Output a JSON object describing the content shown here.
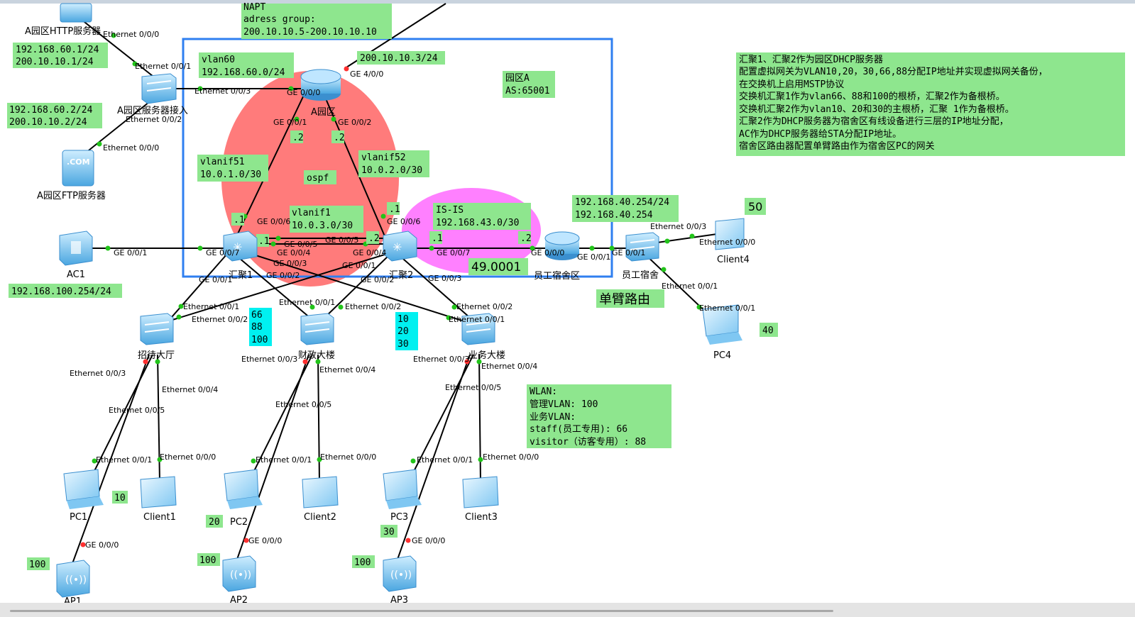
{
  "info_text": {
    "lines": [
      "汇聚1、汇聚2作为园区DHCP服务器",
      "配置虚拟网关为VLAN10,20，30,66,88分配IP地址并实现虚拟网关备份，",
      "在交换机上启用MSTP协议",
      "交换机汇聚1作为vlan66、88和100的根桥，汇聚2作为备根桥。",
      "交换机汇聚2作为vlan10、20和30的主根桥，汇聚 1作为备根桥。",
      "汇聚2作为DHCP服务器为宿舍区有线设备进行三层的IP地址分配，",
      "AC作为DHCP服务器给STA分配IP地址。",
      "宿舍区路由器配置单臂路由作为宿舍区PC的网关"
    ]
  },
  "wlan_box": {
    "lines": [
      "WLAN:",
      "管理VLAN: 100",
      "业务VLAN:",
      "staff(员工专用): 66",
      "visitor（访客专用）: 88"
    ]
  },
  "labels": {
    "napt": [
      "NAPT",
      "adress group:",
      "200.10.10.5-200.10.10.10"
    ],
    "http_ip": [
      "192.168.60.1/24",
      "200.10.10.1/24"
    ],
    "ftp_ip": [
      "192.168.60.2/24",
      "200.10.10.2/24"
    ],
    "vlan60": [
      "vlan60",
      "192.168.60.0/24"
    ],
    "wan_ip": "200.10.10.3/24",
    "campus": [
      "园区A",
      "AS:65001"
    ],
    "vlanif51": [
      "vlanif51",
      "10.0.1.0/30"
    ],
    "vlanif52": [
      "vlanif52",
      "10.0.2.0/30"
    ],
    "vlanif1": [
      "vlanif1",
      "10.0.3.0/30"
    ],
    "ospf": "ospf",
    "isis": [
      "IS-IS",
      "192.168.43.0/30"
    ],
    "isis_net": "49.0001",
    "dorm_ip": [
      "192.168.40.254/24",
      "192.168.40.254"
    ],
    "ac_ip": "192.168.100.254/24",
    "single_arm": "单臂路由",
    "vlan_a": [
      "66",
      "88",
      "100"
    ],
    "vlan_b": [
      "10",
      "20",
      "30"
    ],
    "pc1_vlan": "10",
    "pc2_vlan": "20",
    "pc3_vlan": "30",
    "pc4_vlan": "40",
    "client4_vlan": "50",
    "ap1_vlan": "100",
    "ap2_vlan": "100",
    "ap3_vlan": "100",
    "dot1": ".1",
    "dot2": ".2"
  },
  "devices": {
    "http_server": "A园区HTTP服务器",
    "server_access": "A园区服务器接入",
    "ftp_server": "A园区FTP服务器",
    "router_a": "A园区",
    "core1": "汇聚1",
    "core2": "汇聚2",
    "ac1": "AC1",
    "dorm_router": "员工宿舍区",
    "dorm_switch": "员工宿舍",
    "client4": "Client4",
    "pc4": "PC4",
    "reception": "招待大厅",
    "finance": "财政大楼",
    "business": "业务大楼",
    "pc1": "PC1",
    "client1": "Client1",
    "ap1": "AP1",
    "pc2": "PC2",
    "client2": "Client2",
    "ap2": "AP2",
    "pc3": "PC3",
    "client3": "Client3",
    "ap3": "AP3"
  },
  "ports": {
    "http_e000": "Ethernet 0/0/0",
    "sa_e001": "Ethernet 0/0/1",
    "sa_e003": "Ethernet 0/0/3",
    "sa_e002": "Ethernet 0/0/2",
    "ftp_e000": "Ethernet 0/0/0",
    "ra_ge400": "GE 4/0/0",
    "ra_ge000": "GE 0/0/0",
    "ra_ge001": "GE 0/0/1",
    "ra_ge002": "GE 0/0/2",
    "c1_ge006": "GE 0/0/6",
    "c1_ge007": "GE 0/0/7",
    "c1_ge005": "GE 0/0/5",
    "c1_ge004": "GE 0/0/4",
    "c1_ge003": "GE 0/0/3",
    "c1_ge002": "GE 0/0/2",
    "c1_ge001": "GE 0/0/1",
    "c2_ge005": "GE 0/0/5",
    "c2_ge006": "GE 0/0/6",
    "c2_ge004": "GE 0/0/4",
    "c2_ge001": "GE 0/0/1",
    "c2_ge002": "GE 0/0/2",
    "c2_ge003": "GE 0/0/3",
    "c2_ge007": "GE 0/0/7",
    "ac_ge001": "GE 0/0/1",
    "dr_ge000": "GE 0/0/0",
    "dr_ge001": "GE 0/0/1",
    "ds_ge001": "GE 0/0/1",
    "ds_e003": "Ethernet 0/0/3",
    "ds_e001": "Ethernet 0/0/1",
    "cl4_e000": "Ethernet 0/0/0",
    "pc4_e001": "Ethernet 0/0/1",
    "rh_e001": "Ethernet 0/0/1",
    "rh_e002": "Ethernet 0/0/2",
    "rh_e003": "Ethernet 0/0/3",
    "rh_e004": "Ethernet 0/0/4",
    "rh_e005": "Ethernet 0/0/5",
    "fb_e001": "Ethernet 0/0/1",
    "fb_e003": "Ethernet 0/0/3",
    "fb_e004": "Ethernet 0/0/4",
    "fb_e005": "Ethernet 0/0/5",
    "bb_e002": "Ethernet 0/0/2",
    "bb_e001": "Ethernet 0/0/1",
    "bb_e003": "Ethernet 0/0/3",
    "bb_e004": "Ethernet 0/0/4",
    "bb_e005": "Ethernet 0/0/5",
    "pc1_e001": "Ethernet 0/0/1",
    "cl1_e000": "Ethernet 0/0/0",
    "pc2_e001": "Ethernet 0/0/1",
    "cl2_e000": "Ethernet 0/0/0",
    "pc3_e001": "Ethernet 0/0/1",
    "cl3_e000": "Ethernet 0/0/0",
    "ap1_ge000": "GE 0/0/0",
    "ap2_ge000": "GE 0/0/0",
    "ap3_ge000": "GE 0/0/0"
  },
  "colors": {
    "label_bg": "#8ee68e",
    "vlan_bg": "#00f0f0",
    "ospf_area": "#ff7b7b",
    "isis_area": "#ff80ff",
    "campus_border": "#2f7ff0",
    "device_blue": "#5ab4ec",
    "port_up": "#22c41a",
    "port_down": "#ff3030"
  }
}
